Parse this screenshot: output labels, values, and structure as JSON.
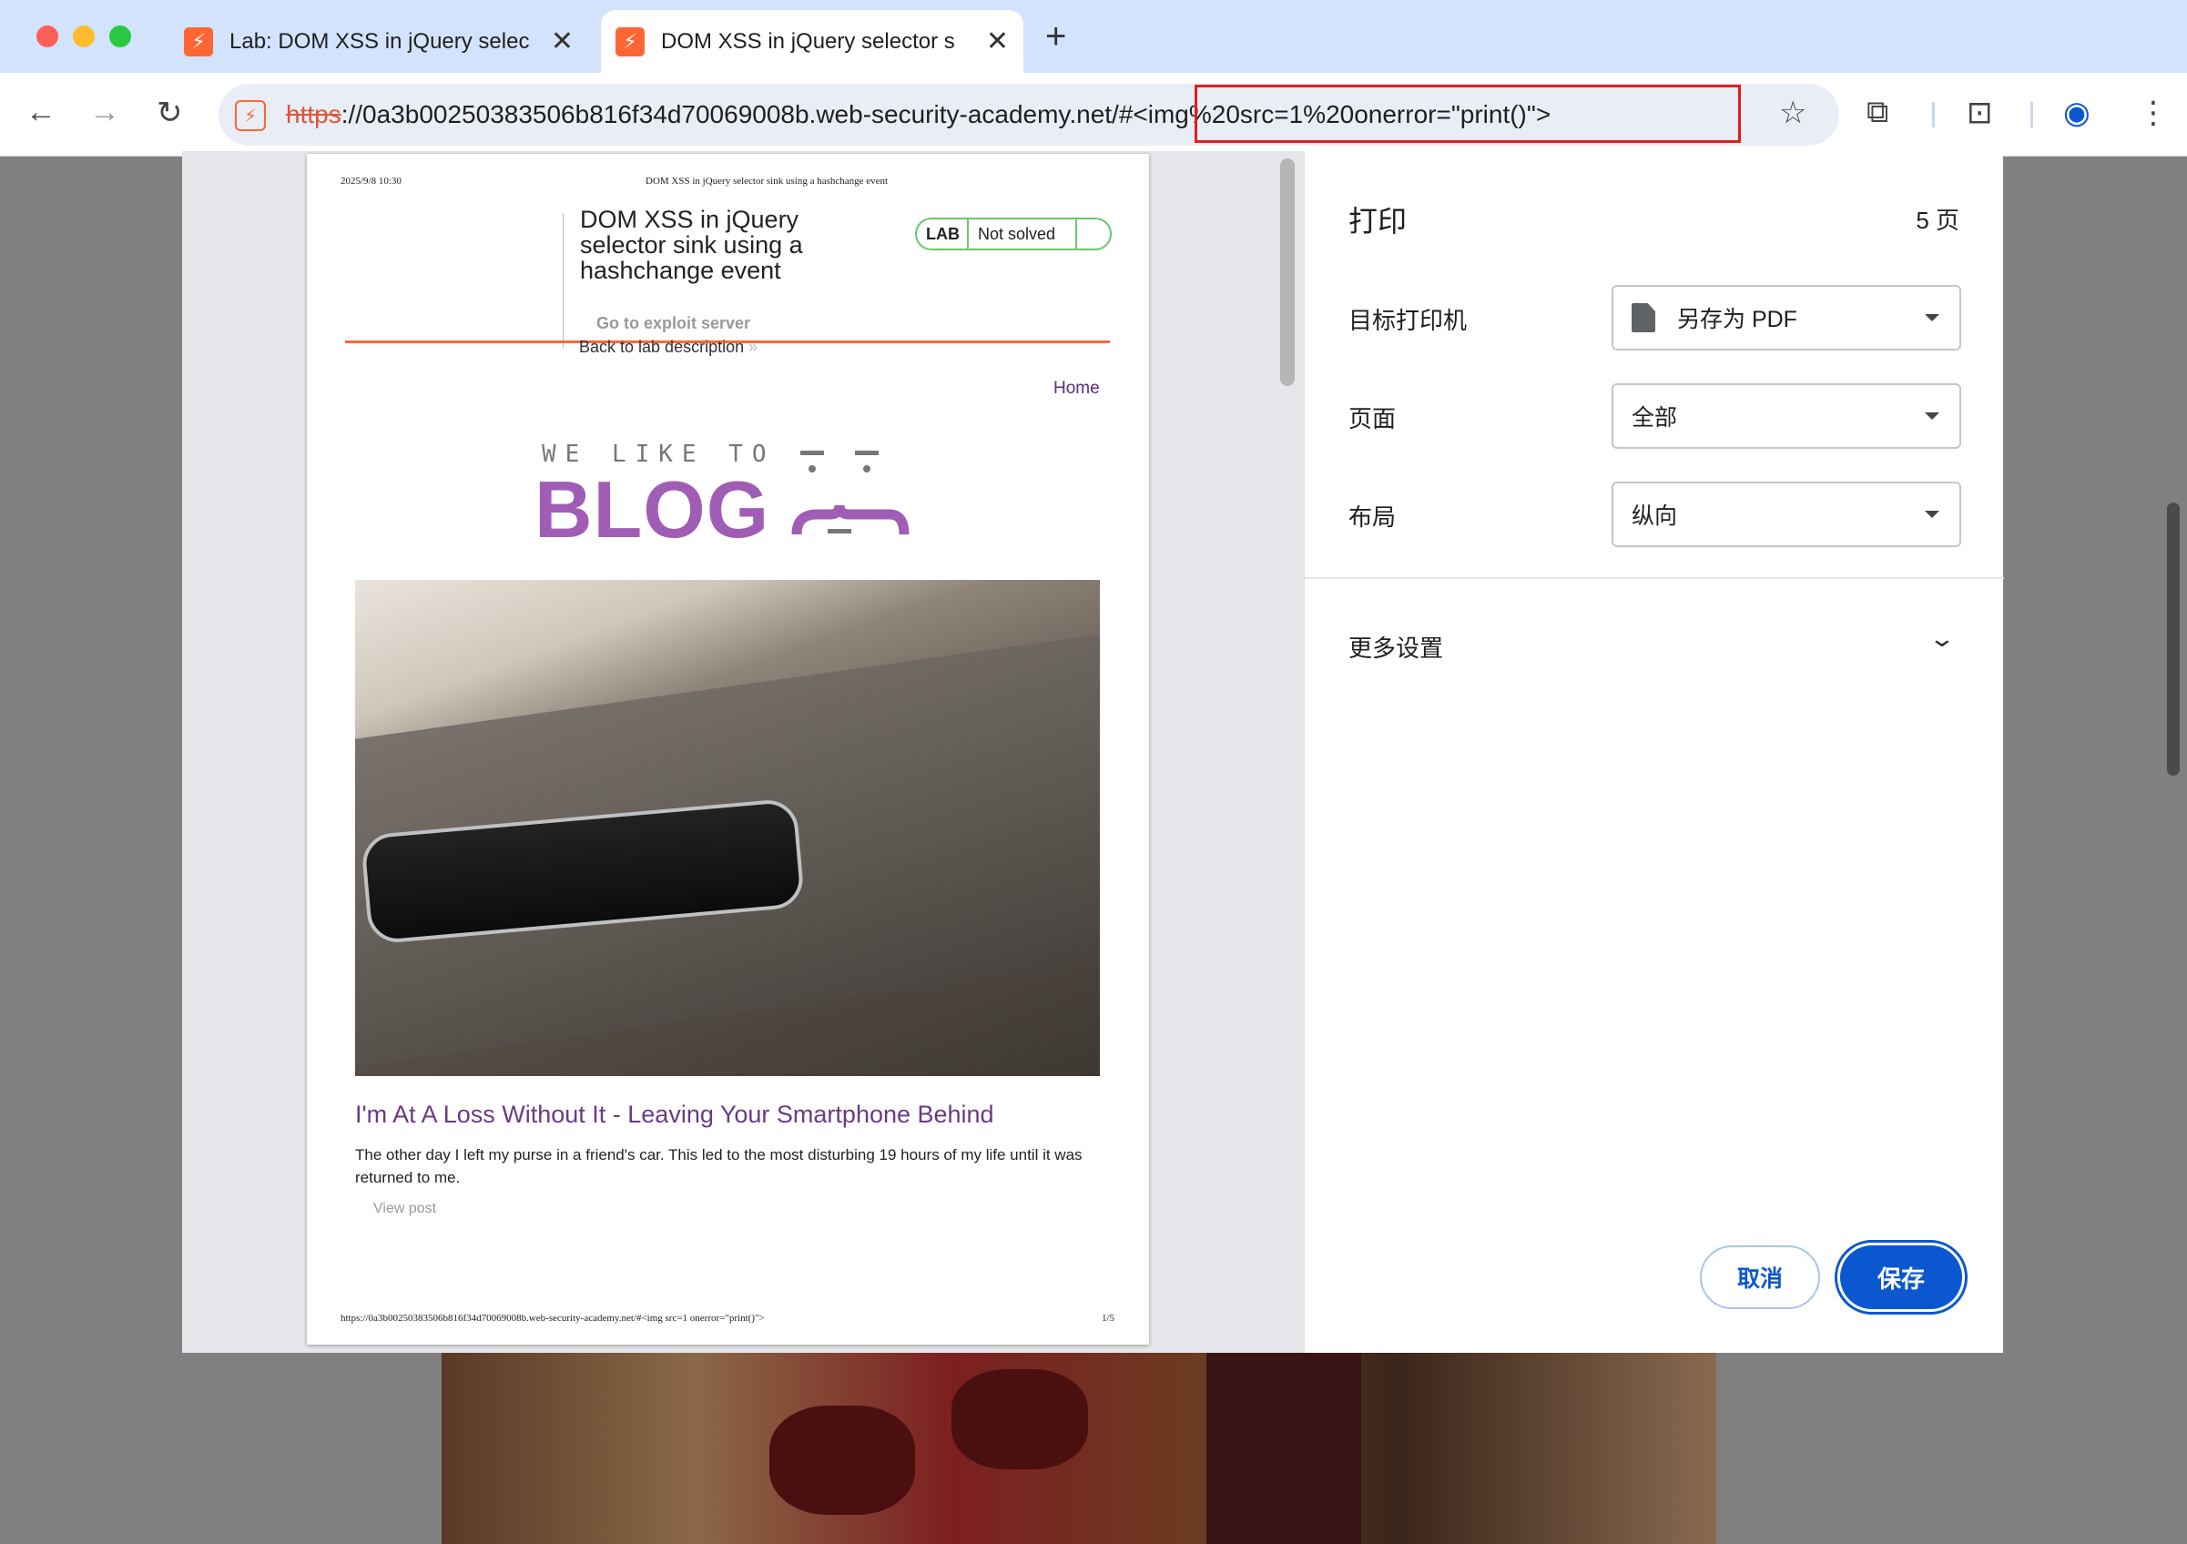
{
  "tabs": [
    {
      "title": "Lab: DOM XSS in jQuery selec",
      "favicon": "lightning-icon",
      "active": false
    },
    {
      "title": "DOM XSS in jQuery selector s",
      "favicon": "lightning-icon",
      "active": true
    }
  ],
  "address": {
    "scheme": "https",
    "rest": "://0a3b00250383506b816f34d70069008b.web-security-academy.net/#<img%20src=1%20onerror=\"print()\">"
  },
  "print": {
    "title": "打印",
    "page_count": "5 页",
    "destination_label": "目标打印机",
    "destination_value": "另存为 PDF",
    "pages_label": "页面",
    "pages_value": "全部",
    "layout_label": "布局",
    "layout_value": "纵向",
    "more_settings": "更多设置",
    "cancel": "取消",
    "save": "保存"
  },
  "preview": {
    "header_date": "2025/9/8 10:30",
    "header_title": "DOM XSS in jQuery selector sink using a hashchange event",
    "lab_title": "DOM XSS in jQuery selector sink using a hashchange event",
    "lab_badge": "LAB",
    "lab_status": "Not solved",
    "exploit_link": "Go to exploit server",
    "back_link": "Back to lab description",
    "back_chevron": "»",
    "home": "Home",
    "logo_top": "WE LIKE TO",
    "logo_main": "BLOG",
    "post_title": "I'm At A Loss Without It - Leaving Your Smartphone Behind",
    "post_body": "The other day I left my purse in a friend's car. This led to the most disturbing 19 hours of my life until it was returned to me.",
    "view_post": "View post",
    "footer_url": "https://0a3b00250383506b816f34d70069008b.web-security-academy.net/#<img src=1 onerror=\"print()\">",
    "footer_page": "1/5"
  },
  "colors": {
    "accent": "#0b57d0",
    "brand": "#ff6633",
    "blog_purple": "#a05db5",
    "highlight": "#e01e1e"
  }
}
